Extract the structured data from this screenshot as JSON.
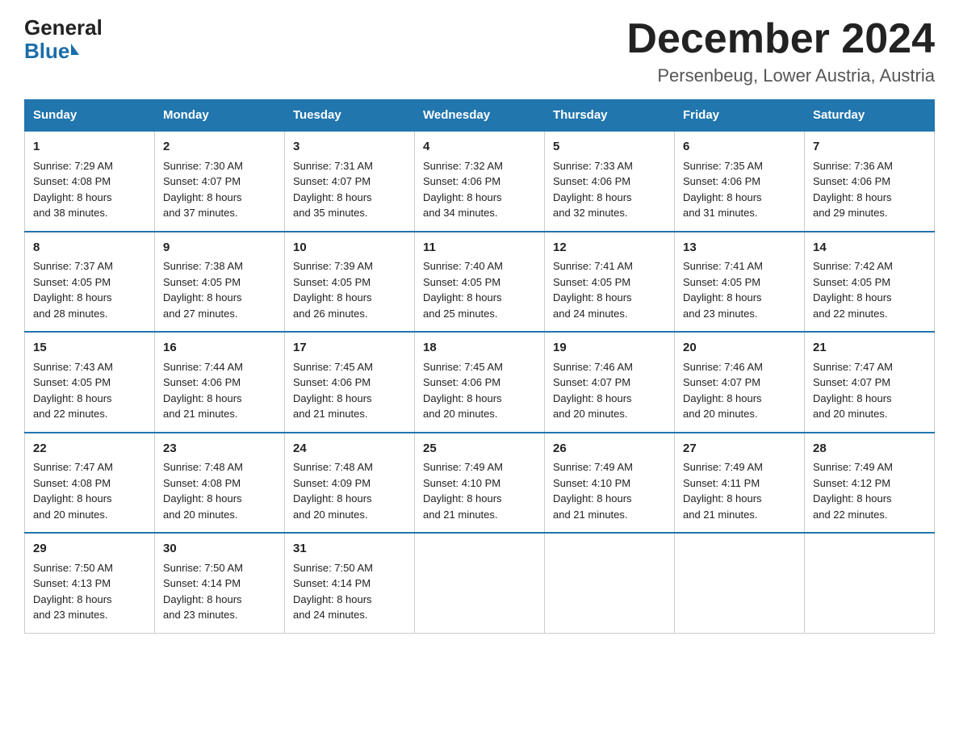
{
  "logo": {
    "general": "General",
    "blue": "Blue"
  },
  "title": "December 2024",
  "location": "Persenbeug, Lower Austria, Austria",
  "headers": [
    "Sunday",
    "Monday",
    "Tuesday",
    "Wednesday",
    "Thursday",
    "Friday",
    "Saturday"
  ],
  "weeks": [
    [
      {
        "day": "1",
        "sunrise": "7:29 AM",
        "sunset": "4:08 PM",
        "daylight": "8 hours and 38 minutes."
      },
      {
        "day": "2",
        "sunrise": "7:30 AM",
        "sunset": "4:07 PM",
        "daylight": "8 hours and 37 minutes."
      },
      {
        "day": "3",
        "sunrise": "7:31 AM",
        "sunset": "4:07 PM",
        "daylight": "8 hours and 35 minutes."
      },
      {
        "day": "4",
        "sunrise": "7:32 AM",
        "sunset": "4:06 PM",
        "daylight": "8 hours and 34 minutes."
      },
      {
        "day": "5",
        "sunrise": "7:33 AM",
        "sunset": "4:06 PM",
        "daylight": "8 hours and 32 minutes."
      },
      {
        "day": "6",
        "sunrise": "7:35 AM",
        "sunset": "4:06 PM",
        "daylight": "8 hours and 31 minutes."
      },
      {
        "day": "7",
        "sunrise": "7:36 AM",
        "sunset": "4:06 PM",
        "daylight": "8 hours and 29 minutes."
      }
    ],
    [
      {
        "day": "8",
        "sunrise": "7:37 AM",
        "sunset": "4:05 PM",
        "daylight": "8 hours and 28 minutes."
      },
      {
        "day": "9",
        "sunrise": "7:38 AM",
        "sunset": "4:05 PM",
        "daylight": "8 hours and 27 minutes."
      },
      {
        "day": "10",
        "sunrise": "7:39 AM",
        "sunset": "4:05 PM",
        "daylight": "8 hours and 26 minutes."
      },
      {
        "day": "11",
        "sunrise": "7:40 AM",
        "sunset": "4:05 PM",
        "daylight": "8 hours and 25 minutes."
      },
      {
        "day": "12",
        "sunrise": "7:41 AM",
        "sunset": "4:05 PM",
        "daylight": "8 hours and 24 minutes."
      },
      {
        "day": "13",
        "sunrise": "7:41 AM",
        "sunset": "4:05 PM",
        "daylight": "8 hours and 23 minutes."
      },
      {
        "day": "14",
        "sunrise": "7:42 AM",
        "sunset": "4:05 PM",
        "daylight": "8 hours and 22 minutes."
      }
    ],
    [
      {
        "day": "15",
        "sunrise": "7:43 AM",
        "sunset": "4:05 PM",
        "daylight": "8 hours and 22 minutes."
      },
      {
        "day": "16",
        "sunrise": "7:44 AM",
        "sunset": "4:06 PM",
        "daylight": "8 hours and 21 minutes."
      },
      {
        "day": "17",
        "sunrise": "7:45 AM",
        "sunset": "4:06 PM",
        "daylight": "8 hours and 21 minutes."
      },
      {
        "day": "18",
        "sunrise": "7:45 AM",
        "sunset": "4:06 PM",
        "daylight": "8 hours and 20 minutes."
      },
      {
        "day": "19",
        "sunrise": "7:46 AM",
        "sunset": "4:07 PM",
        "daylight": "8 hours and 20 minutes."
      },
      {
        "day": "20",
        "sunrise": "7:46 AM",
        "sunset": "4:07 PM",
        "daylight": "8 hours and 20 minutes."
      },
      {
        "day": "21",
        "sunrise": "7:47 AM",
        "sunset": "4:07 PM",
        "daylight": "8 hours and 20 minutes."
      }
    ],
    [
      {
        "day": "22",
        "sunrise": "7:47 AM",
        "sunset": "4:08 PM",
        "daylight": "8 hours and 20 minutes."
      },
      {
        "day": "23",
        "sunrise": "7:48 AM",
        "sunset": "4:08 PM",
        "daylight": "8 hours and 20 minutes."
      },
      {
        "day": "24",
        "sunrise": "7:48 AM",
        "sunset": "4:09 PM",
        "daylight": "8 hours and 20 minutes."
      },
      {
        "day": "25",
        "sunrise": "7:49 AM",
        "sunset": "4:10 PM",
        "daylight": "8 hours and 21 minutes."
      },
      {
        "day": "26",
        "sunrise": "7:49 AM",
        "sunset": "4:10 PM",
        "daylight": "8 hours and 21 minutes."
      },
      {
        "day": "27",
        "sunrise": "7:49 AM",
        "sunset": "4:11 PM",
        "daylight": "8 hours and 21 minutes."
      },
      {
        "day": "28",
        "sunrise": "7:49 AM",
        "sunset": "4:12 PM",
        "daylight": "8 hours and 22 minutes."
      }
    ],
    [
      {
        "day": "29",
        "sunrise": "7:50 AM",
        "sunset": "4:13 PM",
        "daylight": "8 hours and 23 minutes."
      },
      {
        "day": "30",
        "sunrise": "7:50 AM",
        "sunset": "4:14 PM",
        "daylight": "8 hours and 23 minutes."
      },
      {
        "day": "31",
        "sunrise": "7:50 AM",
        "sunset": "4:14 PM",
        "daylight": "8 hours and 24 minutes."
      },
      null,
      null,
      null,
      null
    ]
  ],
  "labels": {
    "sunrise": "Sunrise:",
    "sunset": "Sunset:",
    "daylight": "Daylight:"
  }
}
